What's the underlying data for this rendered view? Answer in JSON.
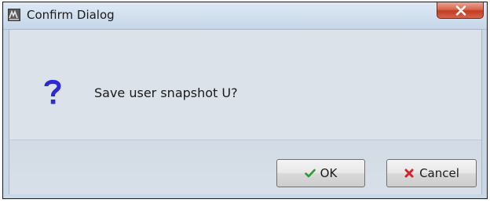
{
  "window": {
    "title": "Confirm Dialog",
    "app_icon": "app-logo-icon",
    "close_icon": "close-icon"
  },
  "dialog": {
    "icon": "question-icon",
    "icon_color": "#2a2bd6",
    "message": "Save user snapshot U?"
  },
  "buttons": {
    "ok": {
      "label": "OK",
      "icon": "checkmark-icon",
      "icon_color": "#2e9a2e"
    },
    "cancel": {
      "label": "Cancel",
      "icon": "cross-icon",
      "icon_color": "#d8222a"
    }
  },
  "colors": {
    "titlebar": "#d3e1ef",
    "close_button": "#c94a30",
    "content_background": "#dde3ea"
  }
}
